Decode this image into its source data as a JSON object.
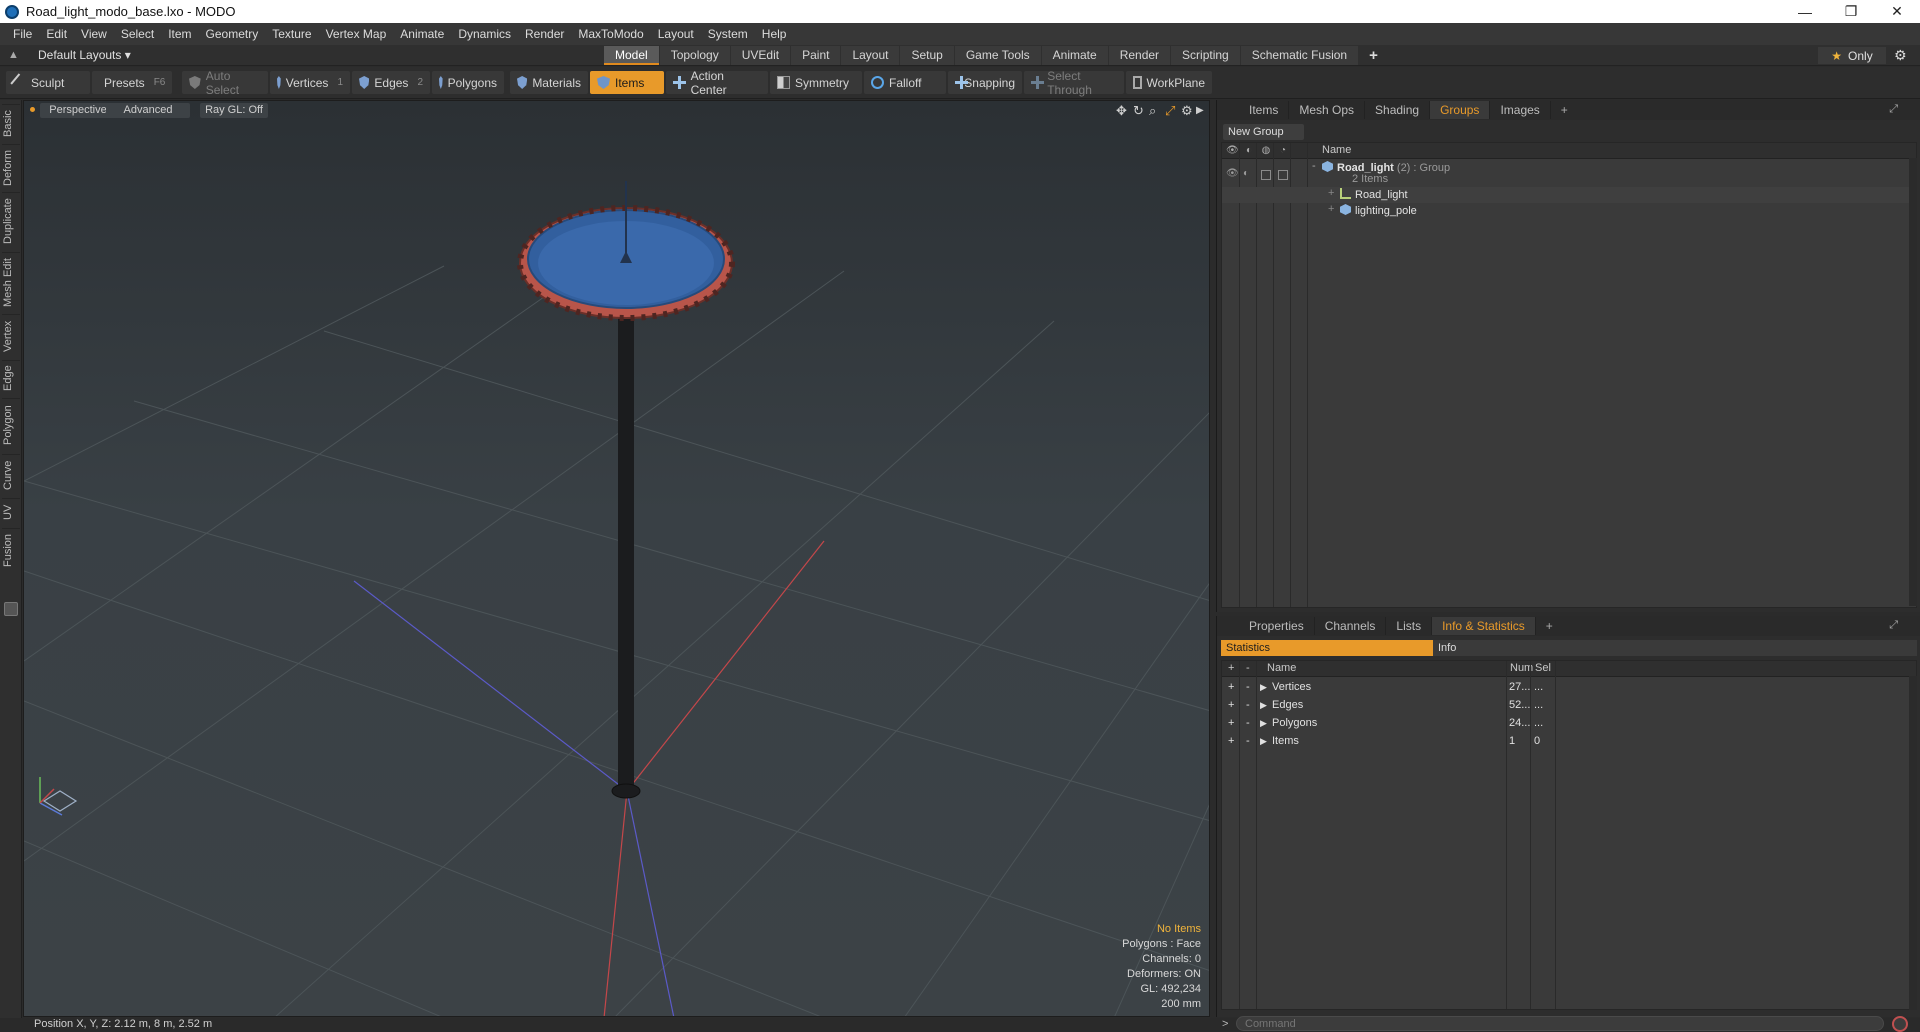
{
  "window": {
    "title": "Road_light_modo_base.lxo - MODO",
    "minimize": "—",
    "maximize": "❐",
    "close": "✕"
  },
  "menus": [
    "File",
    "Edit",
    "View",
    "Select",
    "Item",
    "Geometry",
    "Texture",
    "Vertex Map",
    "Animate",
    "Dynamics",
    "Render",
    "MaxToModo",
    "Layout",
    "System",
    "Help"
  ],
  "layout": {
    "selector": "Default Layouts ▾",
    "tabs": [
      "Model",
      "Topology",
      "UVEdit",
      "Paint",
      "Layout",
      "Setup",
      "Game Tools",
      "Animate",
      "Render",
      "Scripting",
      "Schematic Fusion"
    ],
    "active_tab": "Model",
    "plus": "+",
    "only_label": "Only",
    "only_star": "★"
  },
  "toolbar": {
    "sculpt": "Sculpt",
    "presets": "Presets",
    "presets_key": "F6",
    "auto_select": "Auto Select",
    "vertices": "Vertices",
    "vertices_num": "1",
    "edges": "Edges",
    "edges_num": "2",
    "polygons": "Polygons",
    "materials": "Materials",
    "items": "Items",
    "action_center": "Action Center",
    "symmetry": "Symmetry",
    "falloff": "Falloff",
    "snapping": "Snapping",
    "select_through": "Select Through",
    "workplane": "WorkPlane"
  },
  "left_tabs": [
    "Basic",
    "Deform",
    "Duplicate",
    "Mesh Edit",
    "Vertex",
    "Edge",
    "Polygon",
    "Curve",
    "UV",
    "Fusion"
  ],
  "viewport": {
    "view": "Perspective",
    "shading": "Advanced",
    "raygl": "Ray GL: Off",
    "stats": {
      "no_items": "No Items",
      "polygons": "Polygons : Face",
      "channels": "Channels: 0",
      "deformers": "Deformers: ON",
      "gl": "GL: 492,234",
      "scale": "200 mm"
    }
  },
  "groups_panel": {
    "tabs": [
      "Items",
      "Mesh Ops",
      "Shading",
      "Groups",
      "Images"
    ],
    "active_tab": "Groups",
    "plus": "+",
    "new_group": "New Group",
    "name_header": "Name",
    "group_name": "Road_light",
    "group_count": "(2)",
    "group_type": ": Group",
    "group_items": "2 Items",
    "children": [
      "Road_light",
      "lighting_pole"
    ]
  },
  "info_panel": {
    "tabs": [
      "Properties",
      "Channels",
      "Lists",
      "Info & Statistics"
    ],
    "active_tab": "Info & Statistics",
    "plus": "+",
    "sub_statistics": "Statistics",
    "sub_info": "Info",
    "headers": {
      "name": "Name",
      "num": "Num",
      "sel": "Sel"
    },
    "rows": [
      {
        "name": "Vertices",
        "num": "27...",
        "sel": "..."
      },
      {
        "name": "Edges",
        "num": "52...",
        "sel": "..."
      },
      {
        "name": "Polygons",
        "num": "24...",
        "sel": "..."
      },
      {
        "name": "Items",
        "num": "1",
        "sel": "0"
      }
    ]
  },
  "status": {
    "position": "Position X, Y, Z:   2.12 m, 8 m, 2.52 m",
    "command_prompt": ">",
    "command_placeholder": "Command"
  }
}
